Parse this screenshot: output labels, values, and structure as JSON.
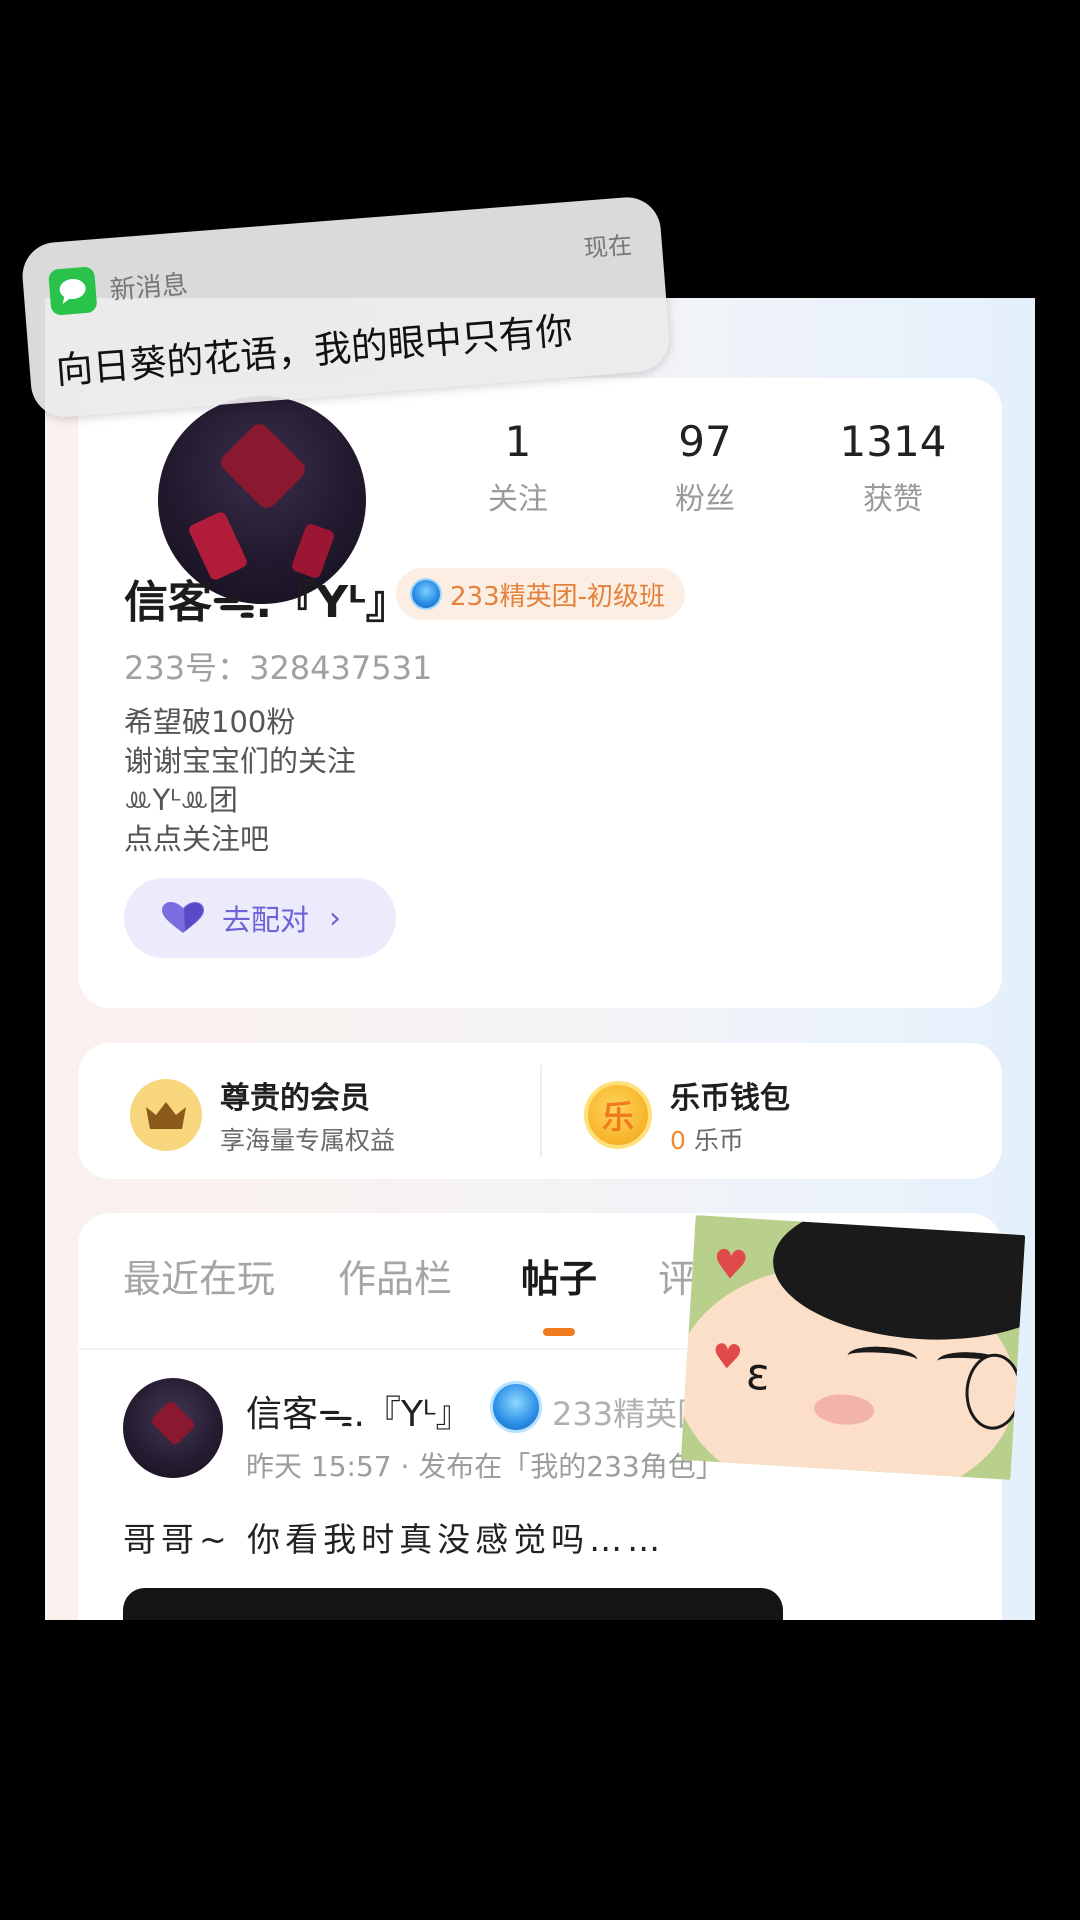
{
  "notification": {
    "app_name": "新消息",
    "time": "现在",
    "message": "向日葵的花语，我的眼中只有你"
  },
  "profile": {
    "stats": [
      {
        "value": "1",
        "label": "关注"
      },
      {
        "value": "97",
        "label": "粉丝"
      },
      {
        "value": "1314",
        "label": "获赞"
      }
    ],
    "username": "信客ᯓ.『Yᴸ』",
    "badge": "233精英团-初级班",
    "id_line": "233号：328437531",
    "bio": [
      "希望破100粉",
      "谢谢宝宝们的关注",
      "ꔛYᴸꔛ团",
      "点点关注吧"
    ],
    "match_button": "去配对",
    "match_chevron": "›"
  },
  "wallet": {
    "vip": {
      "title": "尊贵的会员",
      "subtitle": "享海量专属权益"
    },
    "coins": {
      "title": "乐币钱包",
      "amount": "0",
      "unit": "乐币",
      "icon_text": "乐"
    }
  },
  "tabs": [
    "最近在玩",
    "作品栏",
    "帖子",
    "评论"
  ],
  "active_tab": "帖子",
  "post": {
    "author": "信客ᯓ.『Yᴸ』",
    "badge": "233精英团",
    "meta": "昨天 15:57 · 发布在「我的233角色」",
    "body": "哥哥~ 你看我时真没感觉吗……"
  },
  "colors": {
    "accent": "#f07b1e",
    "match": "#6f62d8",
    "badge_text": "#e4823c"
  }
}
